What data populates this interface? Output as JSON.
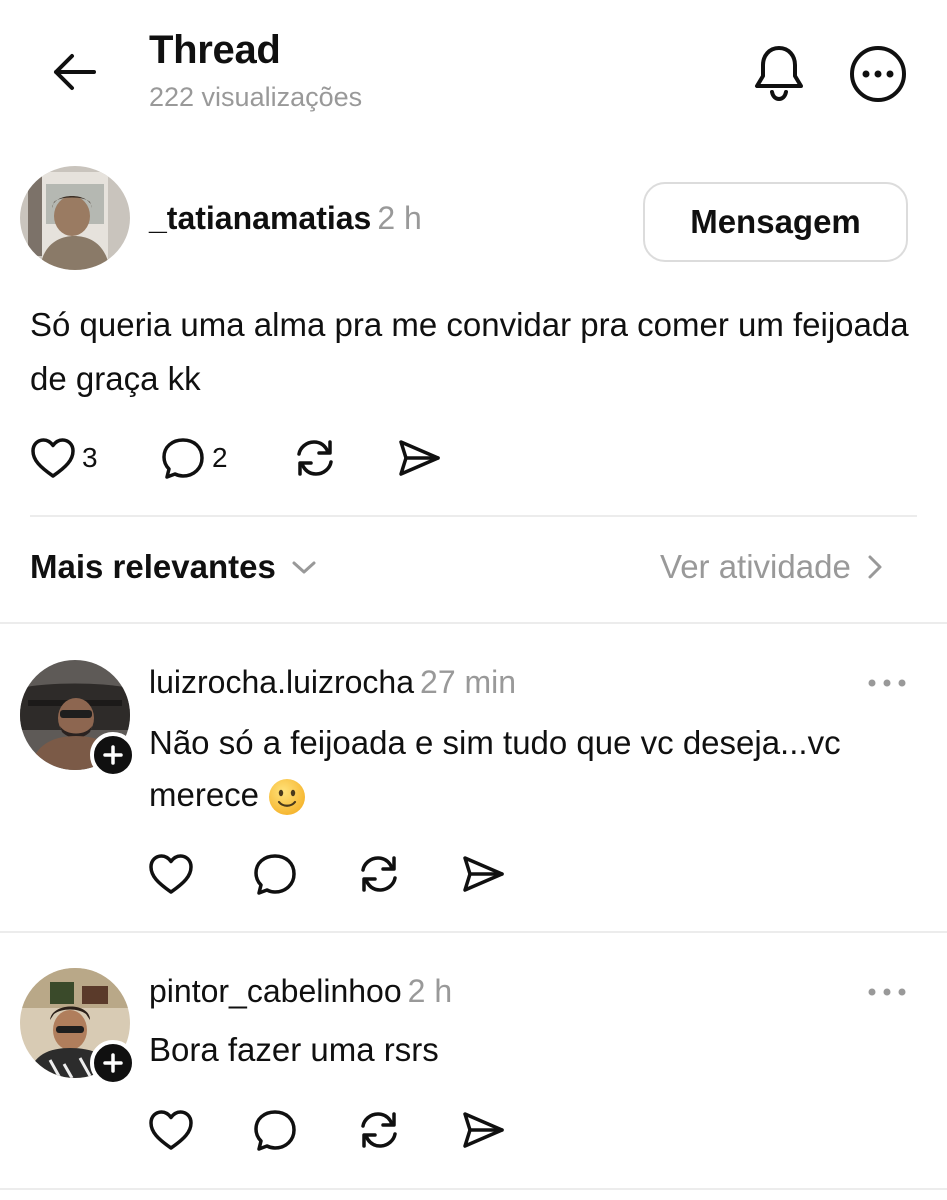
{
  "header": {
    "title": "Thread",
    "views": "222 visualizações"
  },
  "post": {
    "username": "_tatianamatias",
    "time": "2 h",
    "message_button": "Mensagem",
    "text": "Só queria uma alma pra me convidar pra comer um feijoada de graça kk",
    "likes": "3",
    "comments": "2"
  },
  "sort": {
    "label": "Mais relevantes",
    "activity_link": "Ver atividade"
  },
  "replies": [
    {
      "username": "luizrocha.luizrocha",
      "time": "27 min",
      "text": "Não só a feijoada e sim tudo que vc deseja...vc merece",
      "emoji": "slightly-smiling-face"
    },
    {
      "username": "pintor_cabelinhoo",
      "time": "2 h",
      "text": "Bora fazer uma rsrs"
    }
  ],
  "icons": [
    "back-arrow-icon",
    "bell-icon",
    "more-circle-icon",
    "heart-icon",
    "comment-icon",
    "repost-icon",
    "share-icon",
    "chevron-down-icon",
    "chevron-right-icon",
    "plus-icon",
    "more-horizontal-icon"
  ],
  "colors": {
    "text": "#101010",
    "secondary": "#999999",
    "divider": "#ececec",
    "button_border": "#dcdcdc"
  }
}
